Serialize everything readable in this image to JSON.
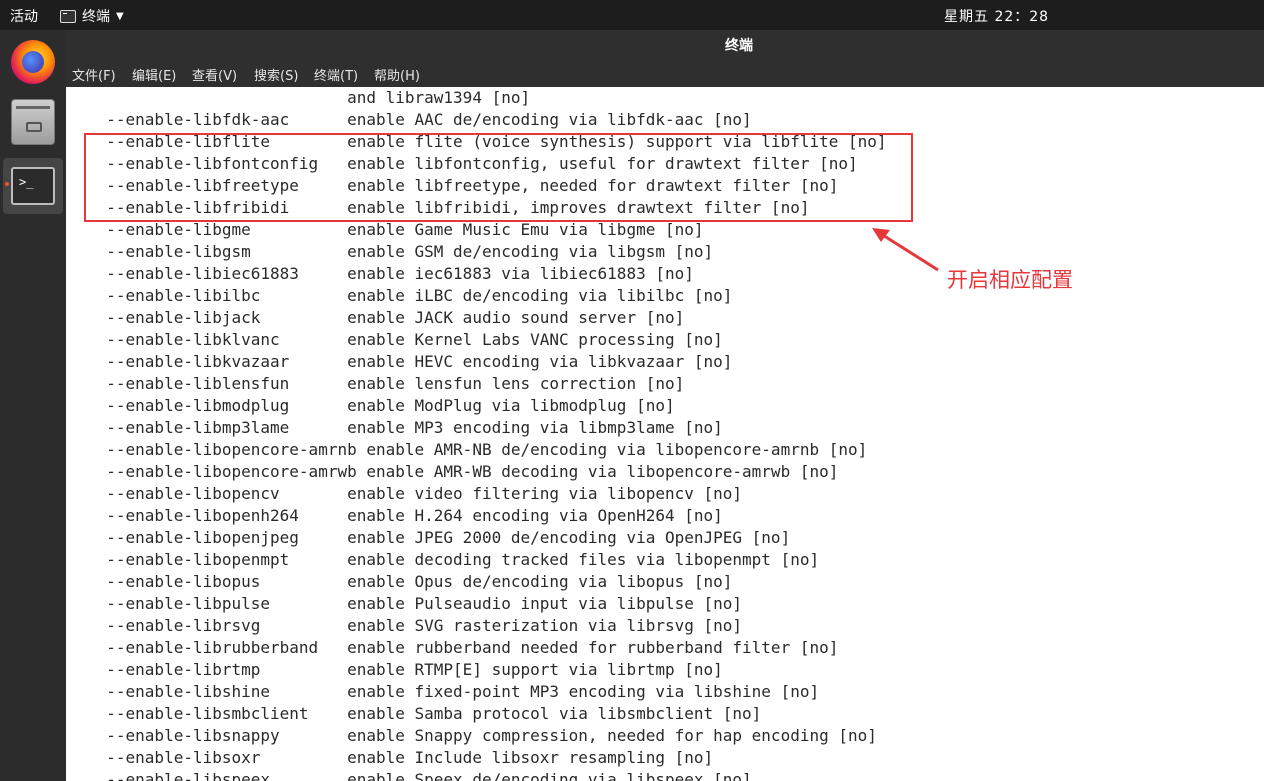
{
  "topbar": {
    "activities": "活动",
    "app_name": "终端",
    "clock": "星期五 22：28"
  },
  "dock": {
    "items": [
      {
        "name": "Firefox",
        "icon": "firefox-icon"
      },
      {
        "name": "Files",
        "icon": "files-icon"
      },
      {
        "name": "Terminal",
        "icon": "terminal-icon",
        "running": true
      }
    ],
    "terminal_glyph": ">_"
  },
  "window": {
    "title": "终端",
    "menu": [
      "文件(F)",
      "编辑(E)",
      "查看(V)",
      "搜索(S)",
      "终端(T)",
      "帮助(H)"
    ]
  },
  "terminal": {
    "lines": [
      "                           and libraw1394 [no]",
      "  --enable-libfdk-aac      enable AAC de/encoding via libfdk-aac [no]",
      "  --enable-libflite        enable flite (voice synthesis) support via libflite [no]",
      "  --enable-libfontconfig   enable libfontconfig, useful for drawtext filter [no]",
      "  --enable-libfreetype     enable libfreetype, needed for drawtext filter [no]",
      "  --enable-libfribidi      enable libfribidi, improves drawtext filter [no]",
      "  --enable-libgme          enable Game Music Emu via libgme [no]",
      "  --enable-libgsm          enable GSM de/encoding via libgsm [no]",
      "  --enable-libiec61883     enable iec61883 via libiec61883 [no]",
      "  --enable-libilbc         enable iLBC de/encoding via libilbc [no]",
      "  --enable-libjack         enable JACK audio sound server [no]",
      "  --enable-libklvanc       enable Kernel Labs VANC processing [no]",
      "  --enable-libkvazaar      enable HEVC encoding via libkvazaar [no]",
      "  --enable-liblensfun      enable lensfun lens correction [no]",
      "  --enable-libmodplug      enable ModPlug via libmodplug [no]",
      "  --enable-libmp3lame      enable MP3 encoding via libmp3lame [no]",
      "  --enable-libopencore-amrnb enable AMR-NB de/encoding via libopencore-amrnb [no]",
      "  --enable-libopencore-amrwb enable AMR-WB decoding via libopencore-amrwb [no]",
      "  --enable-libopencv       enable video filtering via libopencv [no]",
      "  --enable-libopenh264     enable H.264 encoding via OpenH264 [no]",
      "  --enable-libopenjpeg     enable JPEG 2000 de/encoding via OpenJPEG [no]",
      "  --enable-libopenmpt      enable decoding tracked files via libopenmpt [no]",
      "  --enable-libopus         enable Opus de/encoding via libopus [no]",
      "  --enable-libpulse        enable Pulseaudio input via libpulse [no]",
      "  --enable-librsvg         enable SVG rasterization via librsvg [no]",
      "  --enable-librubberband   enable rubberband needed for rubberband filter [no]",
      "  --enable-librtmp         enable RTMP[E] support via librtmp [no]",
      "  --enable-libshine        enable fixed-point MP3 encoding via libshine [no]",
      "  --enable-libsmbclient    enable Samba protocol via libsmbclient [no]",
      "  --enable-libsnappy       enable Snappy compression, needed for hap encoding [no]",
      "  --enable-libsoxr         enable Include libsoxr resampling [no]",
      "  --enable-libspeex        enable Speex de/encoding via libspeex [no]"
    ]
  },
  "annotation": {
    "text": "开启相应配置",
    "color": "#e5383b"
  }
}
